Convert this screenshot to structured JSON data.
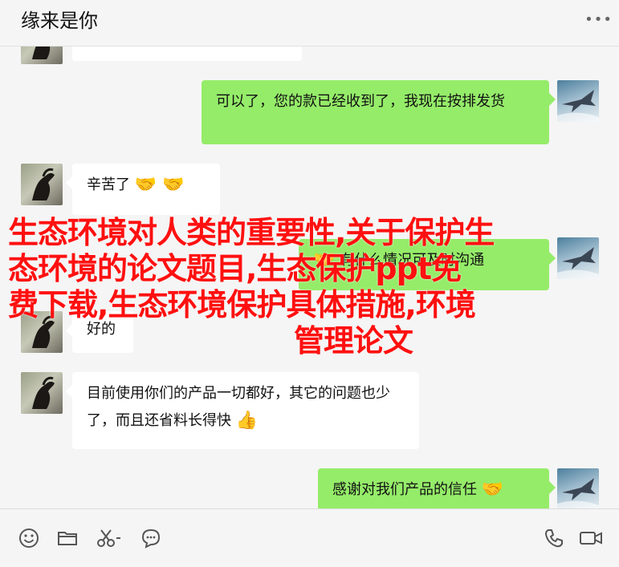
{
  "window": {
    "title": "缘来是你",
    "more_icon": "more-dots-icon"
  },
  "messages": [
    {
      "side": "left",
      "text": "",
      "icon": "horse-avatar"
    },
    {
      "side": "right",
      "text": "可以了，您的款已经收到了，我现在按排发货",
      "icon": "jet-avatar"
    },
    {
      "side": "left",
      "text": "辛苦了",
      "emoji": "🤝 🤝",
      "icon": "horse-avatar"
    },
    {
      "side": "right",
      "text": "有什么情况可及时沟通",
      "emoji": "🤝",
      "icon": "jet-avatar"
    },
    {
      "side": "left",
      "text": "好的",
      "icon": "horse-avatar"
    },
    {
      "side": "left",
      "text": "目前使用你们的产品一切都好，其它的问题也少了，而且还省料长得快",
      "emoji": "👍",
      "icon": "horse-avatar"
    },
    {
      "side": "right",
      "text": "感谢对我们产品的信任",
      "emoji": "🤝",
      "icon": "jet-avatar"
    }
  ],
  "overlay": {
    "line1": "生态环境对人类的重要性,关于保护生",
    "line2": "态环境的论文题目,生态保护ppt免",
    "line3": "费下载,生态环境保护具体措施,环境",
    "line4": "管理论文"
  },
  "toolbar": {
    "left_icons": [
      "emoji-icon",
      "folder-icon",
      "scissors-icon",
      "chat-bubble-icon"
    ],
    "right_icons": [
      "phone-icon",
      "video-icon"
    ]
  },
  "colors": {
    "sent_bubble": "#95ec69",
    "received_bubble": "#ffffff",
    "overlay_text": "#ff1010"
  }
}
